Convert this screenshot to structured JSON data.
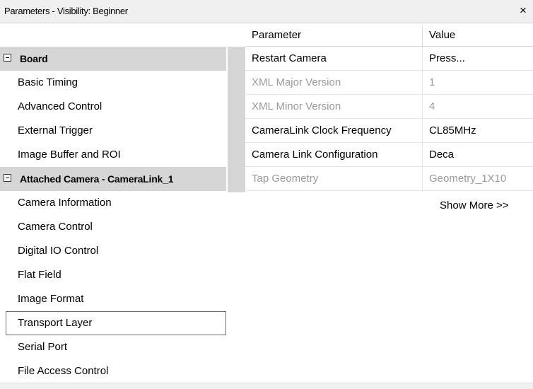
{
  "window": {
    "title": "Parameters - Visibility: Beginner",
    "close_glyph": "×"
  },
  "sidebar": {
    "categories": [
      {
        "label": "Board",
        "items": [
          "Basic Timing",
          "Advanced Control",
          "External Trigger",
          "Image Buffer and ROI"
        ]
      },
      {
        "label": "Attached Camera - CameraLink_1",
        "items": [
          "Camera Information",
          "Camera Control",
          "Digital IO Control",
          "Flat Field",
          "Image Format",
          "Transport Layer",
          "Serial Port",
          "File Access Control"
        ]
      }
    ],
    "selected_item": "Transport Layer"
  },
  "grid": {
    "headers": {
      "parameter": "Parameter",
      "value": "Value"
    },
    "rows": [
      {
        "name": "Restart Camera",
        "value": "Press...",
        "enabled": true
      },
      {
        "name": "XML Major Version",
        "value": "1",
        "enabled": false
      },
      {
        "name": "XML Minor Version",
        "value": "4",
        "enabled": false
      },
      {
        "name": "CameraLink Clock Frequency",
        "value": "CL85MHz",
        "enabled": true
      },
      {
        "name": "Camera Link Configuration",
        "value": "Deca",
        "enabled": true
      },
      {
        "name": "Tap Geometry",
        "value": "Geometry_1X10",
        "enabled": false
      }
    ],
    "show_more": "Show More >>"
  }
}
